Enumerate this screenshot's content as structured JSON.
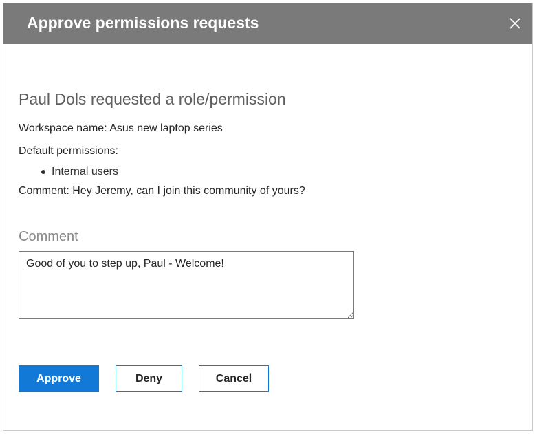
{
  "dialog": {
    "title": "Approve permissions requests",
    "close_icon": "close-icon"
  },
  "request": {
    "heading": "Paul Dols requested a role/permission",
    "workspace_label": "Workspace name: ",
    "workspace_value": "Asus new laptop series",
    "default_permissions_label": "Default permissions:",
    "permissions": [
      "Internal users"
    ],
    "comment_label": "Comment: ",
    "comment_value": "Hey Jeremy, can I join this community of yours?"
  },
  "response": {
    "comment_field_label": "Comment",
    "comment_field_value": "Good of you to step up, Paul - Welcome!"
  },
  "actions": {
    "approve_label": "Approve",
    "deny_label": "Deny",
    "cancel_label": "Cancel"
  },
  "colors": {
    "titlebar": "#7a7a7a",
    "accent": "#1379d6"
  }
}
